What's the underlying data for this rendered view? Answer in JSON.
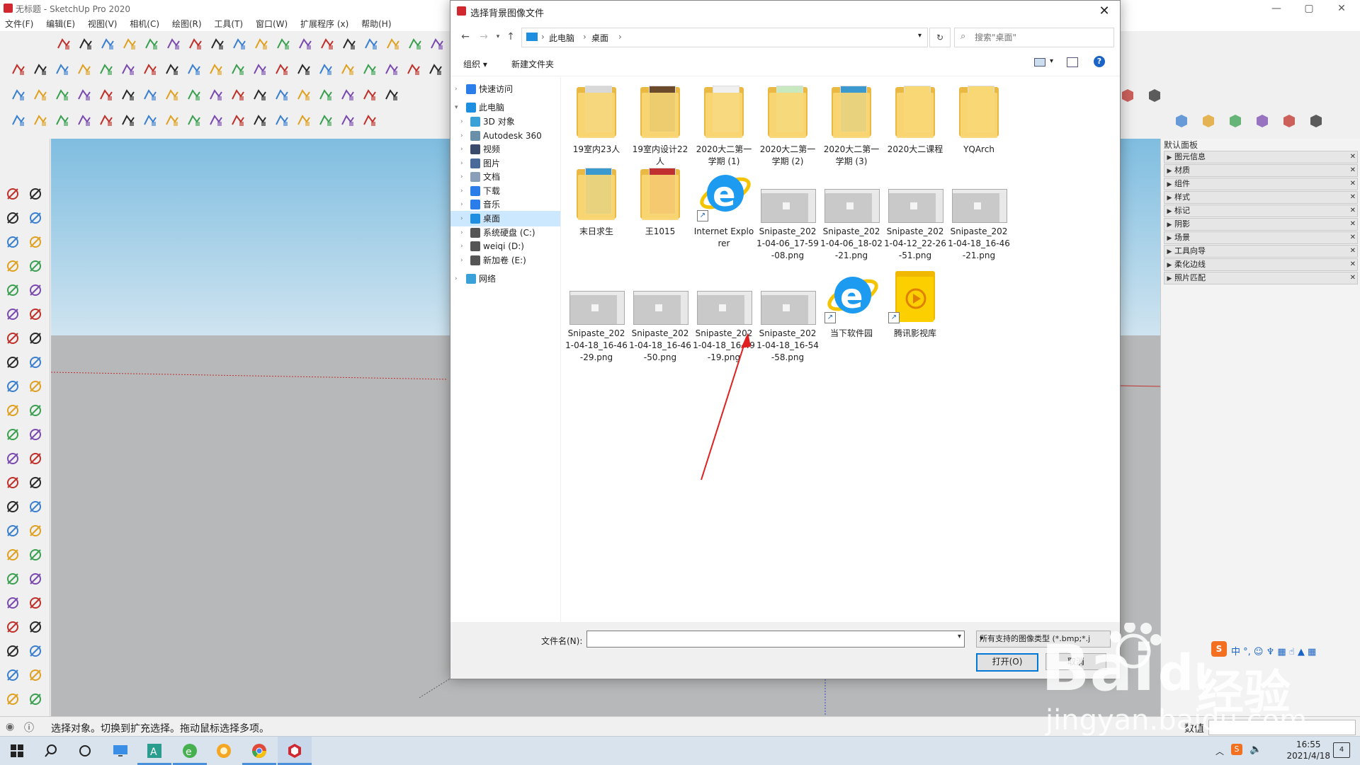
{
  "window": {
    "title": "无标题 - SketchUp Pro 2020",
    "minimize": "—",
    "maximize": "▢",
    "close": "✕"
  },
  "menu": [
    "文件(F)",
    "编辑(E)",
    "视图(V)",
    "相机(C)",
    "绘图(R)",
    "工具(T)",
    "窗口(W)",
    "扩展程序 (x)",
    "帮助(H)"
  ],
  "tray": {
    "title": "默认面板",
    "items": [
      "图元信息",
      "材质",
      "组件",
      "样式",
      "标记",
      "阴影",
      "场景",
      "工具向导",
      "柔化边线",
      "照片匹配"
    ]
  },
  "status": {
    "message": "选择对象。切换到扩充选择。拖动鼠标选择多项。",
    "measure_label": "数值"
  },
  "taskbar": {
    "time": "16:55",
    "date": "2021/4/18",
    "notifications": "4"
  },
  "dialog": {
    "title": "选择背景图像文件",
    "close": "✕",
    "breadcrumb": [
      "此电脑",
      "桌面"
    ],
    "search_placeholder": "搜索\"桌面\"",
    "organize": "组织 ▾",
    "new_folder": "新建文件夹",
    "nav": [
      {
        "label": "快速访问",
        "level": 0,
        "icon": "star-icon"
      },
      {
        "label": "此电脑",
        "level": 0,
        "icon": "computer-icon"
      },
      {
        "label": "3D 对象",
        "level": 1,
        "icon": "cube-icon"
      },
      {
        "label": "Autodesk 360",
        "level": 1,
        "icon": "cloud-icon"
      },
      {
        "label": "视频",
        "level": 1,
        "icon": "video-icon"
      },
      {
        "label": "图片",
        "level": 1,
        "icon": "picture-icon"
      },
      {
        "label": "文档",
        "level": 1,
        "icon": "document-icon"
      },
      {
        "label": "下载",
        "level": 1,
        "icon": "download-icon"
      },
      {
        "label": "音乐",
        "level": 1,
        "icon": "music-icon"
      },
      {
        "label": "桌面",
        "level": 1,
        "icon": "desktop-icon",
        "selected": true
      },
      {
        "label": "系统硬盘 (C:)",
        "level": 1,
        "icon": "drive-icon"
      },
      {
        "label": "weiqi (D:)",
        "level": 1,
        "icon": "drive-icon"
      },
      {
        "label": "新加卷 (E:)",
        "level": 1,
        "icon": "drive-icon"
      },
      {
        "label": "网络",
        "level": 0,
        "icon": "network-icon"
      }
    ],
    "files": [
      {
        "name": "19室内23人",
        "type": "folder"
      },
      {
        "name": "19室内设计22人",
        "type": "folder"
      },
      {
        "name": "2020大二第一学期 (1)",
        "type": "folder"
      },
      {
        "name": "2020大二第一学期 (2)",
        "type": "folder"
      },
      {
        "name": "2020大二第一学期 (3)",
        "type": "folder"
      },
      {
        "name": "2020大二课程",
        "type": "folder"
      },
      {
        "name": "YQArch",
        "type": "folder"
      },
      {
        "name": "末日求生",
        "type": "folder"
      },
      {
        "name": "王1015",
        "type": "folder"
      },
      {
        "name": "Internet Explorer",
        "type": "ie"
      },
      {
        "name": "Snipaste_2021-04-06_17-59-08.png",
        "type": "image"
      },
      {
        "name": "Snipaste_2021-04-06_18-02-21.png",
        "type": "image"
      },
      {
        "name": "Snipaste_2021-04-12_22-26-51.png",
        "type": "image"
      },
      {
        "name": "Snipaste_2021-04-18_16-46-21.png",
        "type": "image"
      },
      {
        "name": "Snipaste_2021-04-18_16-46-29.png",
        "type": "image"
      },
      {
        "name": "Snipaste_2021-04-18_16-46-50.png",
        "type": "image"
      },
      {
        "name": "Snipaste_2021-04-18_16-49-19.png",
        "type": "image"
      },
      {
        "name": "Snipaste_2021-04-18_16-54-58.png",
        "type": "image"
      },
      {
        "name": "当下软件园",
        "type": "ie"
      },
      {
        "name": "腾讯影视库",
        "type": "video-folder"
      }
    ],
    "filename_label": "文件名(N):",
    "filename_value": "",
    "filter": "所有支持的图像类型 (*.bmp;*.j",
    "open": "打开(O)",
    "cancel": "取消"
  },
  "watermark": {
    "cn": "经验",
    "url": "jingyan.baidu.com"
  },
  "colors": {
    "accent": "#0078d7",
    "selected": "#cce8ff",
    "folder": "#f8d775",
    "annotation": "#e02020"
  }
}
